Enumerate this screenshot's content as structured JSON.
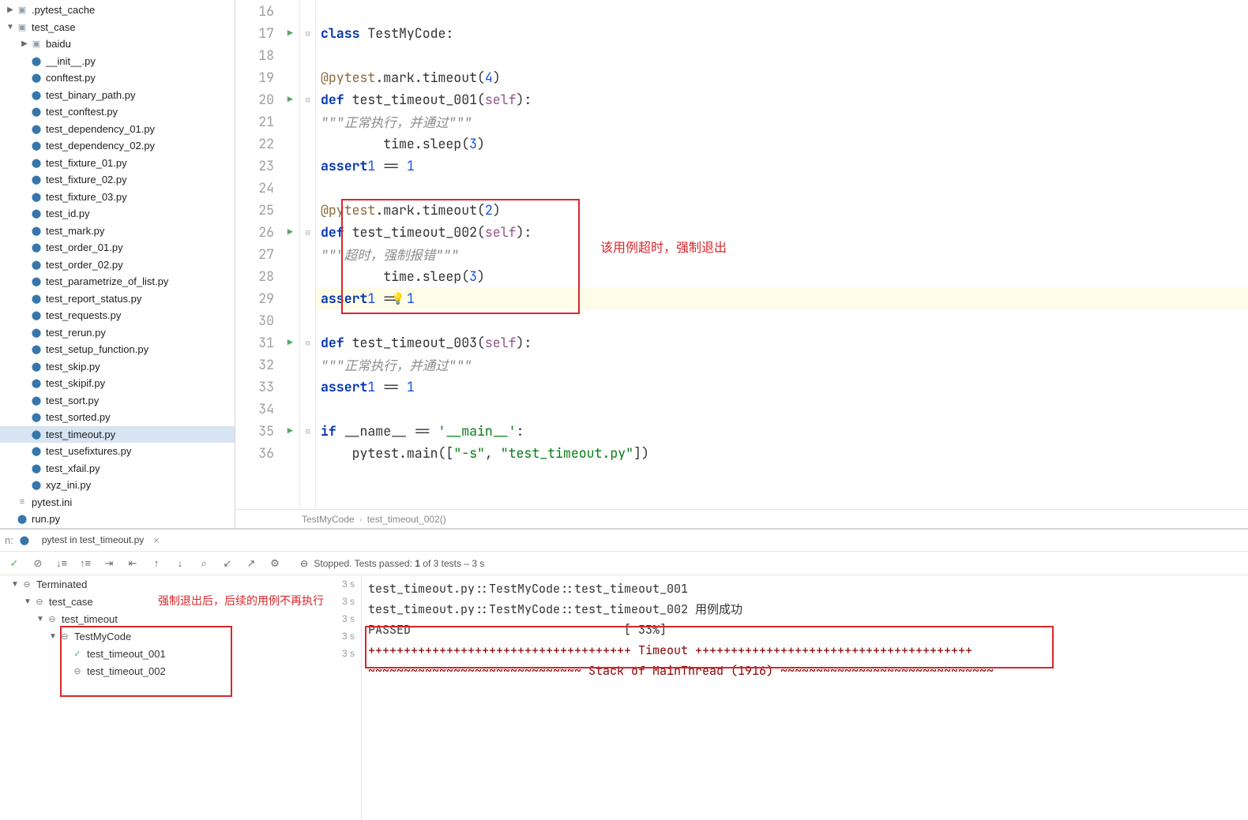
{
  "tree": {
    "pytest_cache": ".pytest_cache",
    "test_case": "test_case",
    "baidu": "baidu",
    "files": [
      "__init__.py",
      "conftest.py",
      "test_binary_path.py",
      "test_conftest.py",
      "test_dependency_01.py",
      "test_dependency_02.py",
      "test_fixture_01.py",
      "test_fixture_02.py",
      "test_fixture_03.py",
      "test_id.py",
      "test_mark.py",
      "test_order_01.py",
      "test_order_02.py",
      "test_parametrize_of_list.py",
      "test_report_status.py",
      "test_requests.py",
      "test_rerun.py",
      "test_setup_function.py",
      "test_skip.py",
      "test_skipif.py",
      "test_sort.py",
      "test_sorted.py",
      "test_timeout.py",
      "test_usefixtures.py",
      "test_xfail.py",
      "xyz_ini.py"
    ],
    "pytest_ini": "pytest.ini",
    "run_py": "run.py"
  },
  "selected_file": "test_timeout.py",
  "editor": {
    "lines": [
      {
        "n": 16,
        "run": false,
        "code": ""
      },
      {
        "n": 17,
        "run": true,
        "code": "class TestMyCode:",
        "cls": " "
      },
      {
        "n": 18,
        "run": false,
        "code": ""
      },
      {
        "n": 19,
        "run": false,
        "code": "    @pytest.mark.timeout(4)"
      },
      {
        "n": 20,
        "run": true,
        "code": "    def test_timeout_001(self):"
      },
      {
        "n": 21,
        "run": false,
        "code": "        \"\"\"正常执行，并通过\"\"\""
      },
      {
        "n": 22,
        "run": false,
        "code": "        time.sleep(3)"
      },
      {
        "n": 23,
        "run": false,
        "code": "        assert 1 == 1"
      },
      {
        "n": 24,
        "run": false,
        "code": ""
      },
      {
        "n": 25,
        "run": false,
        "code": "    @pytest.mark.timeout(2)"
      },
      {
        "n": 26,
        "run": true,
        "code": "    def test_timeout_002(self):"
      },
      {
        "n": 27,
        "run": false,
        "code": "        \"\"\"超时，强制报错\"\"\""
      },
      {
        "n": 28,
        "run": false,
        "code": "        time.sleep(3)"
      },
      {
        "n": 29,
        "run": false,
        "code": "        assert 1 == 1",
        "hl": true
      },
      {
        "n": 30,
        "run": false,
        "code": ""
      },
      {
        "n": 31,
        "run": true,
        "code": "    def test_timeout_003(self):"
      },
      {
        "n": 32,
        "run": false,
        "code": "        \"\"\"正常执行，并通过\"\"\""
      },
      {
        "n": 33,
        "run": false,
        "code": "        assert 1 == 1"
      },
      {
        "n": 34,
        "run": false,
        "code": ""
      },
      {
        "n": 35,
        "run": true,
        "code": "if __name__ == '__main__':"
      },
      {
        "n": 36,
        "run": false,
        "code": "    pytest.main([\"-s\", \"test_timeout.py\"])"
      }
    ]
  },
  "breadcrumb": {
    "a": "TestMyCode",
    "b": "test_timeout_002()"
  },
  "annotations": {
    "box1_comment": "该用例超时，强制退出",
    "tree_comment": "强制退出后，后续的用例不再执行"
  },
  "run": {
    "tab_prefix": "n:",
    "tab": "pytest in test_timeout.py",
    "status": {
      "pre": "Stopped. Tests passed: ",
      "passed": "1",
      "mid": " of 3 tests – 3 s"
    },
    "tree": [
      {
        "name": "Terminated",
        "time": "3 s",
        "icon": "term",
        "depth": 0,
        "chev": "▼"
      },
      {
        "name": "test_case",
        "time": "3 s",
        "icon": "term",
        "depth": 1,
        "chev": "▼"
      },
      {
        "name": "test_timeout",
        "time": "3 s",
        "icon": "term",
        "depth": 2,
        "chev": "▼"
      },
      {
        "name": "TestMyCode",
        "time": "3 s",
        "icon": "term",
        "depth": 3,
        "chev": "▼"
      },
      {
        "name": "test_timeout_001",
        "time": "3 s",
        "icon": "pass",
        "depth": 4,
        "chev": ""
      },
      {
        "name": "test_timeout_002",
        "time": "",
        "icon": "term",
        "depth": 4,
        "chev": ""
      }
    ],
    "console": [
      {
        "t": "test_timeout.py::TestMyCode::test_timeout_001",
        "c": ""
      },
      {
        "t": "test_timeout.py::TestMyCode::test_timeout_002 用例成功",
        "c": ""
      },
      {
        "t": "PASSED                              [ 33%]",
        "c": ""
      },
      {
        "t": "+++++++++++++++++++++++++++++++++++++ Timeout +++++++++++++++++++++++++++++++++++++++",
        "c": "con-red"
      },
      {
        "t": "",
        "c": ""
      },
      {
        "t": "~~~~~~~~~~~~~~~~~~~~~~~~~~~~~~ Stack of MainThread (1916) ~~~~~~~~~~~~~~~~~~~~~~~~~~~~~~",
        "c": "con-red"
      }
    ]
  }
}
